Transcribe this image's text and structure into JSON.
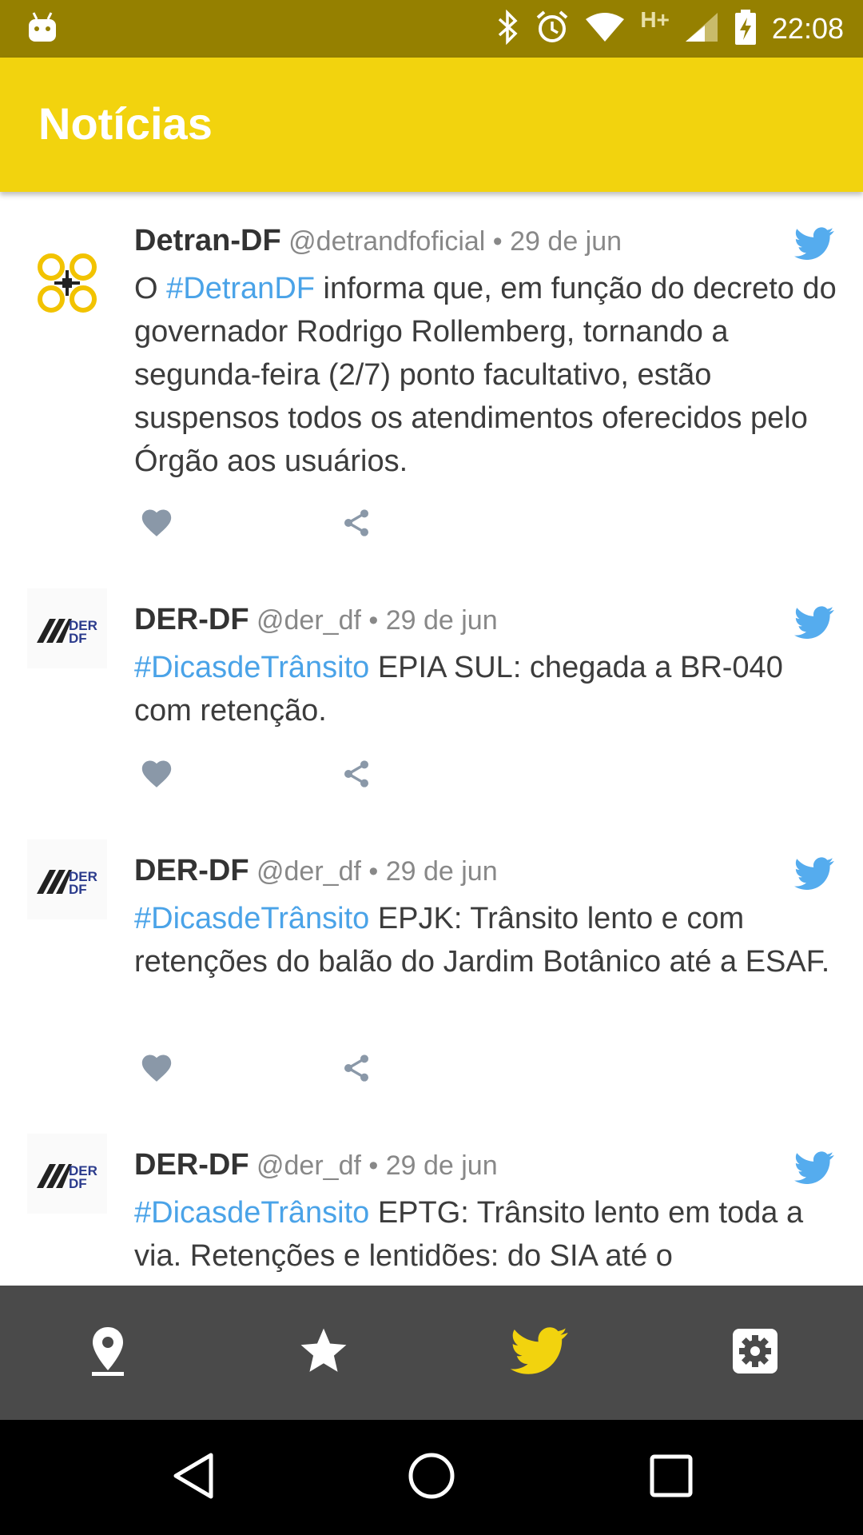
{
  "status_bar": {
    "time": "22:08",
    "network_type": "H+",
    "icons": [
      "android-icon",
      "bluetooth-icon",
      "alarm-icon",
      "wifi-icon",
      "signal-icon",
      "battery-icon"
    ]
  },
  "app_bar": {
    "title": "Notícias"
  },
  "tweets": [
    {
      "name": "Detran-DF",
      "handle": "@detrandfoficial",
      "date": "• 29 de jun",
      "hashtag": "",
      "prefix": "O ",
      "hashtag_inline": "#DetranDF",
      "text": " informa que, em função do decreto do governador Rodrigo Rollemberg, tornando a segunda-feira (2/7) ponto facultativo, estão suspensos todos os atendimentos oferecidos pelo Órgão aos usuários."
    },
    {
      "name": "DER-DF",
      "handle": "@der_df",
      "date": "• 29 de jun",
      "hashtag": "#DicasdeTrânsito",
      "text": " EPIA SUL: chegada a BR-040 com retenção."
    },
    {
      "name": "DER-DF",
      "handle": "@der_df",
      "date": "• 29 de jun",
      "hashtag": "#DicasdeTrânsito",
      "text": " EPJK: Trânsito lento e com retenções do balão do Jardim Botânico até a ESAF."
    },
    {
      "name": "DER-DF",
      "handle": "@der_df",
      "date": "• 29 de jun",
      "hashtag": "#DicasdeTrânsito",
      "text": " EPTG: Trânsito lento em toda a via. Retenções e lentidões: do SIA até o"
    }
  ],
  "tab_bar": {
    "tabs": [
      "location-tab",
      "favorites-tab",
      "news-tab",
      "settings-tab"
    ],
    "active_tab": "news-tab",
    "active_color": "#f2d30e",
    "inactive_color": "#ffffff"
  },
  "colors": {
    "status_bar": "#958000",
    "app_bar": "#f2d30e",
    "hashtag": "#4aa3e8",
    "twitter_blue": "#55acee",
    "action_gray": "#8a98a8"
  }
}
